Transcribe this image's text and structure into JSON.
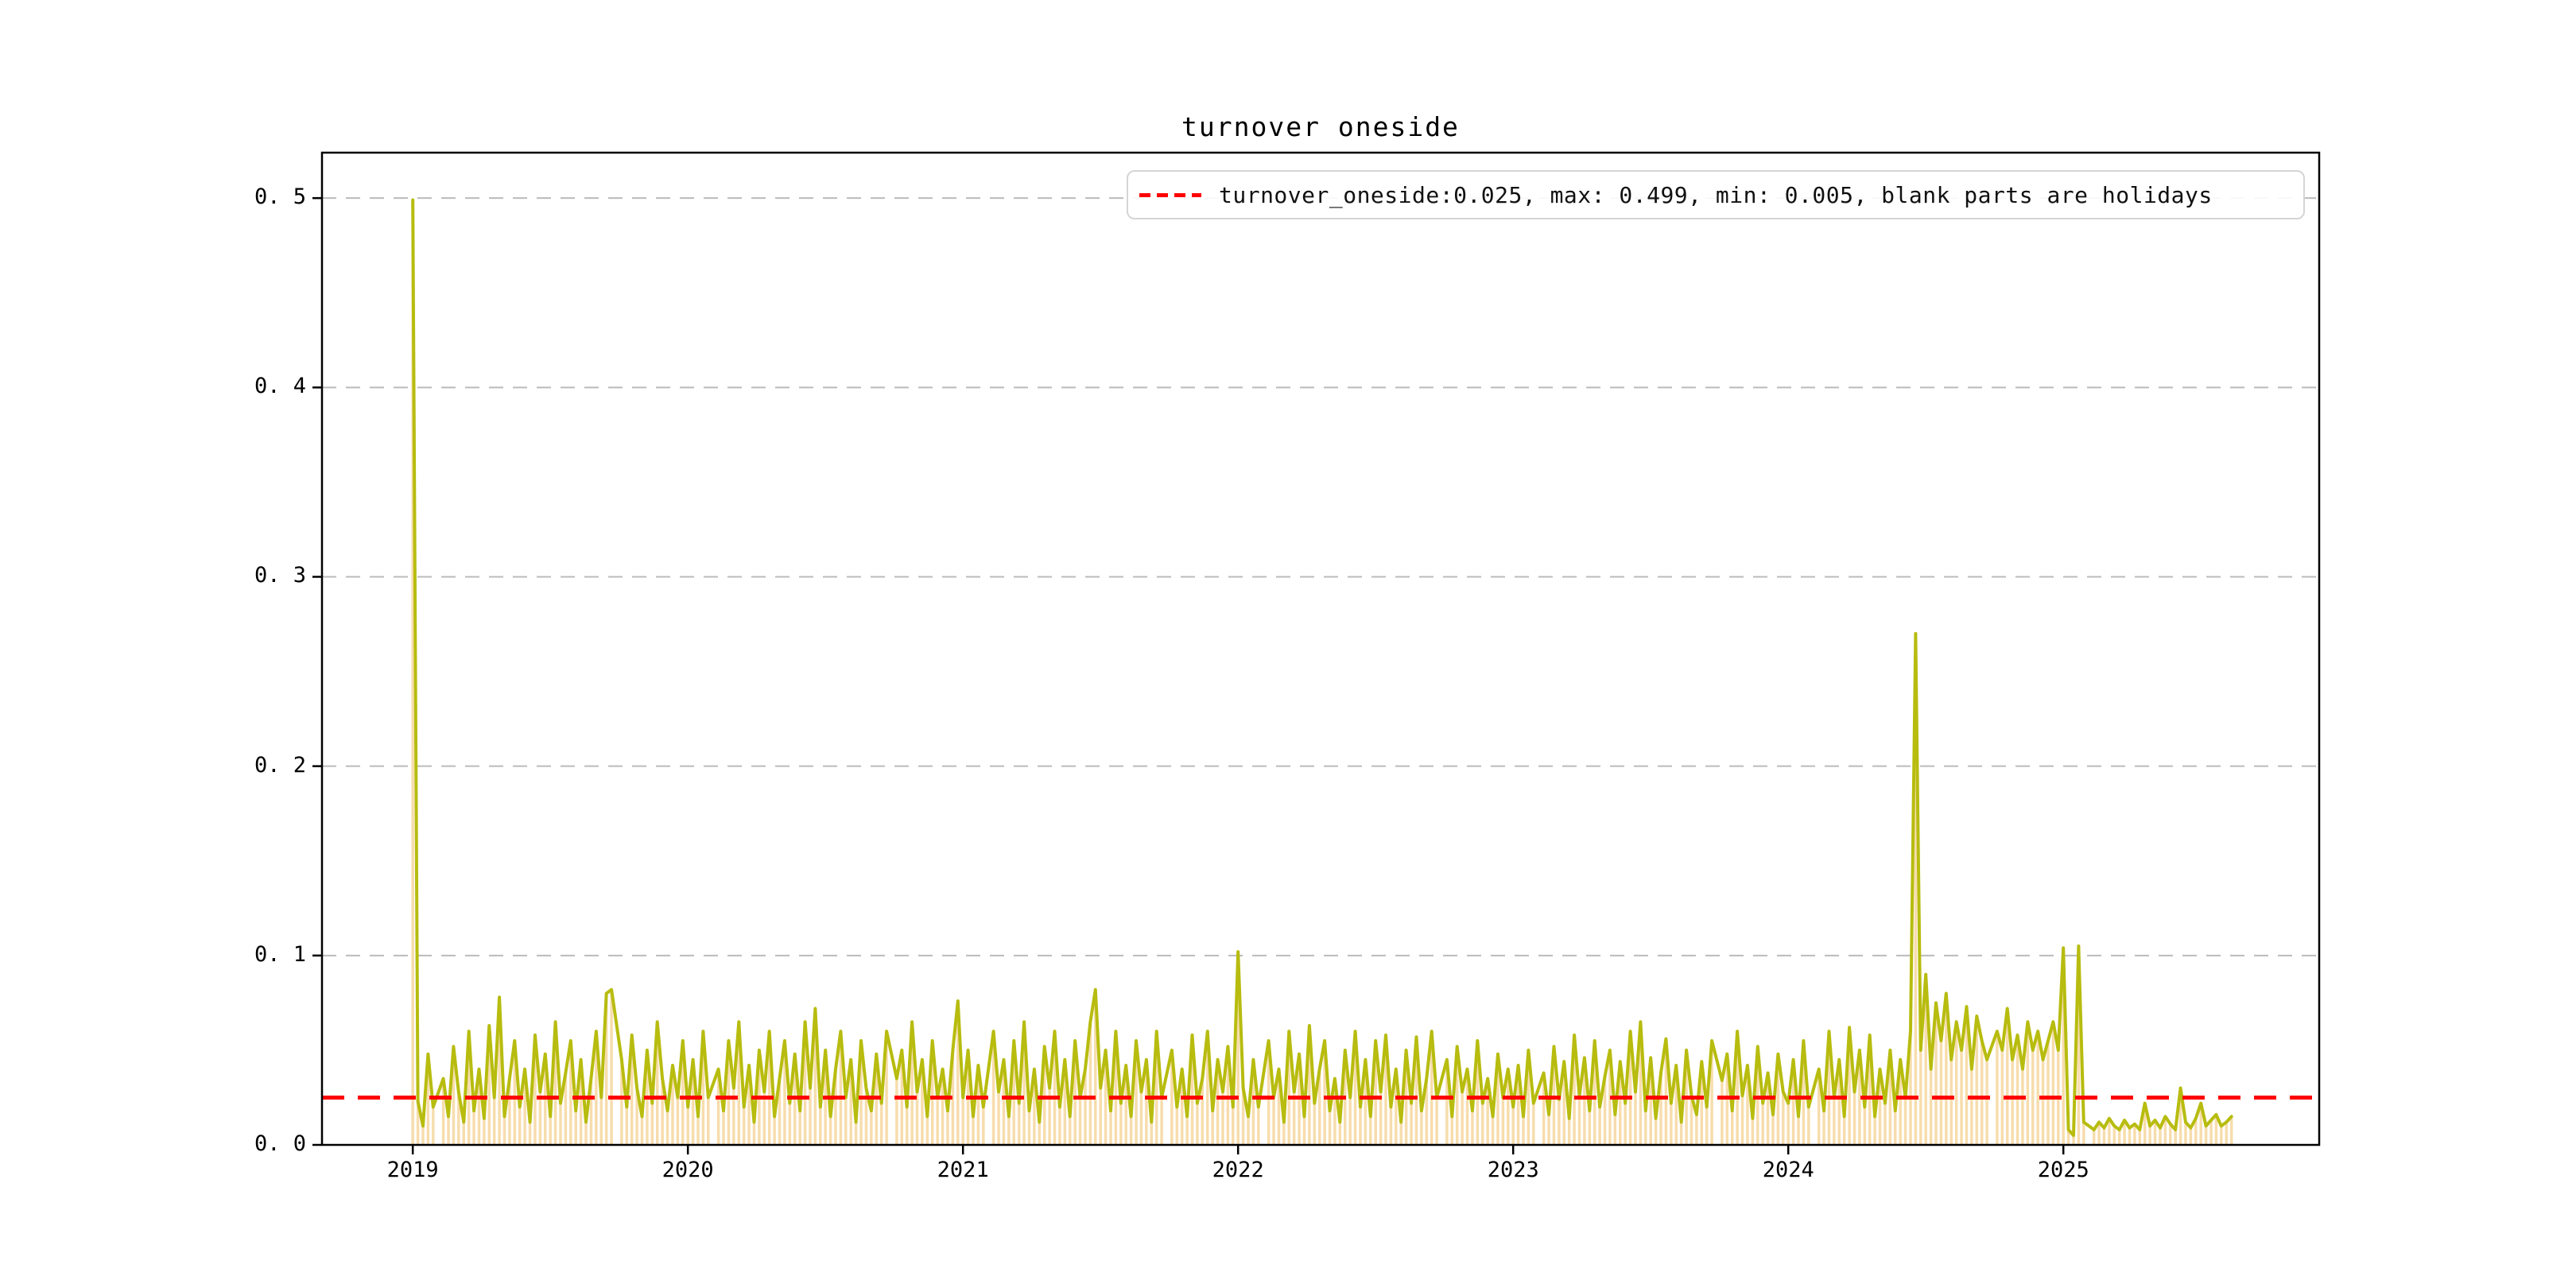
{
  "chart_data": {
    "type": "line",
    "title": "turnover oneside",
    "legend": {
      "label": "turnover_oneside:0.025, max: 0.499, min: 0.005, blank parts are holidays",
      "sample_style": "red-dashed-line"
    },
    "stats": {
      "turnover_oneside": 0.025,
      "max": 0.499,
      "min": 0.005
    },
    "threshold": 0.025,
    "holidays_note": "blank parts are holidays",
    "grid": "horizontal-dashed",
    "legend_position": "upper right",
    "ylim": [
      0,
      0.524
    ],
    "xlim_years": [
      2018.67,
      2025.93
    ],
    "x_ticks": [
      {
        "label": "2019",
        "value": 2019
      },
      {
        "label": "2020",
        "value": 2020
      },
      {
        "label": "2021",
        "value": 2021
      },
      {
        "label": "2022",
        "value": 2022
      },
      {
        "label": "2023",
        "value": 2023
      },
      {
        "label": "2024",
        "value": 2024
      },
      {
        "label": "2025",
        "value": 2025
      }
    ],
    "y_ticks": [
      {
        "label": "0. 0",
        "value": 0.0
      },
      {
        "label": "0. 1",
        "value": 0.1
      },
      {
        "label": "0. 2",
        "value": 0.2
      },
      {
        "label": "0. 3",
        "value": 0.3
      },
      {
        "label": "0. 4",
        "value": 0.4
      },
      {
        "label": "0. 5",
        "value": 0.5
      }
    ],
    "colors": {
      "line": "#b7bc0f",
      "bars": "#f7ddad",
      "threshold": "#ff0000",
      "grid": "#bbbbbb",
      "spine": "#000000"
    },
    "x_start": 2019.0,
    "x_step_years": 0.0185185,
    "values": [
      0.499,
      0.023,
      0.01,
      0.048,
      0.02,
      null,
      0.035,
      0.015,
      0.052,
      0.028,
      0.012,
      0.06,
      0.018,
      0.04,
      0.014,
      0.063,
      0.025,
      0.078,
      0.015,
      0.035,
      0.055,
      0.02,
      0.04,
      0.012,
      0.058,
      0.028,
      0.048,
      0.015,
      0.065,
      0.022,
      0.038,
      0.055,
      0.018,
      0.045,
      0.012,
      0.035,
      0.06,
      0.025,
      0.08,
      0.082,
      null,
      0.045,
      0.02,
      0.058,
      0.03,
      0.015,
      0.05,
      0.022,
      0.065,
      0.035,
      0.018,
      0.042,
      0.025,
      0.055,
      0.02,
      0.045,
      0.015,
      0.06,
      0.025,
      null,
      0.04,
      0.018,
      0.055,
      0.03,
      0.065,
      0.02,
      0.042,
      0.012,
      0.05,
      0.028,
      0.06,
      0.015,
      0.035,
      0.055,
      0.022,
      0.048,
      0.018,
      0.065,
      0.03,
      0.072,
      0.02,
      0.05,
      0.015,
      0.04,
      0.06,
      0.025,
      0.045,
      0.012,
      0.055,
      0.03,
      0.018,
      0.048,
      0.022,
      0.06,
      null,
      0.035,
      0.05,
      0.02,
      0.065,
      0.028,
      0.045,
      0.015,
      0.055,
      0.025,
      0.04,
      0.018,
      0.05,
      0.076,
      0.025,
      0.05,
      0.015,
      0.042,
      0.02,
      null,
      0.06,
      0.028,
      0.045,
      0.015,
      0.055,
      0.022,
      0.065,
      0.018,
      0.04,
      0.012,
      0.052,
      0.03,
      0.06,
      0.02,
      0.045,
      0.015,
      0.055,
      0.025,
      0.04,
      0.065,
      0.082,
      0.03,
      0.05,
      0.018,
      0.06,
      0.022,
      0.042,
      0.015,
      0.055,
      0.028,
      0.045,
      0.012,
      0.06,
      0.025,
      null,
      0.05,
      0.02,
      0.04,
      0.015,
      0.058,
      0.022,
      0.035,
      0.06,
      0.018,
      0.045,
      0.028,
      0.052,
      0.02,
      0.102,
      0.03,
      0.015,
      0.045,
      0.02,
      null,
      0.055,
      0.025,
      0.04,
      0.012,
      0.06,
      0.028,
      0.048,
      0.015,
      0.063,
      0.022,
      0.04,
      0.055,
      0.018,
      0.035,
      0.012,
      0.05,
      0.025,
      0.06,
      0.02,
      0.045,
      0.015,
      0.055,
      0.028,
      0.058,
      0.02,
      0.04,
      0.012,
      0.05,
      0.022,
      0.057,
      0.018,
      0.035,
      0.06,
      0.025,
      null,
      0.045,
      0.015,
      0.052,
      0.028,
      0.04,
      0.018,
      0.055,
      0.022,
      0.035,
      0.015,
      0.048,
      0.025,
      0.04,
      0.02,
      0.042,
      0.015,
      0.05,
      0.022,
      null,
      0.038,
      0.016,
      0.052,
      0.024,
      0.044,
      0.014,
      0.058,
      0.026,
      0.046,
      0.018,
      0.055,
      0.02,
      0.036,
      0.05,
      0.016,
      0.044,
      0.022,
      0.06,
      0.028,
      0.065,
      0.018,
      0.046,
      0.014,
      0.038,
      0.056,
      0.022,
      0.042,
      0.012,
      0.05,
      0.026,
      0.016,
      0.044,
      0.02,
      0.055,
      null,
      0.034,
      0.048,
      0.018,
      0.06,
      0.026,
      0.042,
      0.014,
      0.052,
      0.022,
      0.038,
      0.016,
      0.048,
      0.028,
      0.022,
      0.045,
      0.015,
      0.055,
      0.02,
      null,
      0.04,
      0.018,
      0.06,
      0.025,
      0.045,
      0.015,
      0.062,
      0.028,
      0.05,
      0.02,
      0.058,
      0.015,
      0.04,
      0.022,
      0.05,
      0.018,
      0.045,
      0.025,
      0.06,
      0.27,
      0.05,
      0.09,
      0.04,
      0.075,
      0.055,
      0.08,
      0.045,
      0.065,
      0.05,
      0.073,
      0.04,
      0.068,
      0.055,
      0.045,
      null,
      0.06,
      0.05,
      0.072,
      0.045,
      0.058,
      0.04,
      0.065,
      0.05,
      0.06,
      0.045,
      0.055,
      0.065,
      0.05,
      0.104,
      0.008,
      0.005,
      0.105,
      0.012,
      null,
      0.008,
      0.012,
      0.009,
      0.014,
      0.01,
      0.008,
      0.013,
      0.009,
      0.011,
      0.008,
      0.022,
      0.01,
      0.013,
      0.009,
      0.015,
      0.011,
      0.008,
      0.03,
      0.012,
      0.009,
      0.014,
      0.022,
      0.01,
      0.013,
      0.016,
      0.01,
      0.012,
      0.015
    ]
  }
}
